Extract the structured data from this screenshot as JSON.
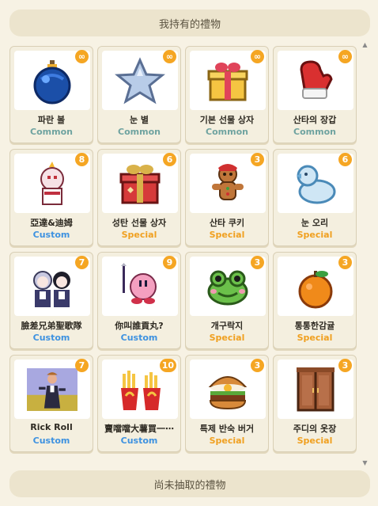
{
  "top_header": {
    "title": "我持有的禮物"
  },
  "bottom_header": {
    "title": "尚未抽取的禮物"
  },
  "scrollbar": {
    "up_arrow": "▲",
    "down_arrow": "▼"
  },
  "gifts": [
    {
      "name": "파란 볼",
      "rarity": "Common",
      "count": "∞",
      "icon": "blue-ornament-icon"
    },
    {
      "name": "눈 별",
      "rarity": "Common",
      "count": "∞",
      "icon": "snow-star-icon"
    },
    {
      "name": "기본 선물 상자",
      "rarity": "Common",
      "count": "∞",
      "icon": "basic-gift-box-icon"
    },
    {
      "name": "산타의 장갑",
      "rarity": "Common",
      "count": "∞",
      "icon": "santa-mitten-icon"
    },
    {
      "name": "亞達&迪姆",
      "rarity": "Custom",
      "count": "8",
      "icon": "character-pair-icon"
    },
    {
      "name": "성탄 선물 상자",
      "rarity": "Special",
      "count": "6",
      "icon": "christmas-gift-box-icon"
    },
    {
      "name": "산타 쿠키",
      "rarity": "Special",
      "count": "3",
      "icon": "gingerbread-cookie-icon"
    },
    {
      "name": "눈 오리",
      "rarity": "Special",
      "count": "6",
      "icon": "snow-duck-icon"
    },
    {
      "name": "臉差兄弟聖歌隊",
      "rarity": "Custom",
      "count": "7",
      "icon": "choir-pair-icon"
    },
    {
      "name": "你叫誰貢丸?",
      "rarity": "Custom",
      "count": "9",
      "icon": "pink-ball-character-icon"
    },
    {
      "name": "개구락지",
      "rarity": "Special",
      "count": "3",
      "icon": "frog-icon"
    },
    {
      "name": "통통한감귤",
      "rarity": "Special",
      "count": "3",
      "icon": "tangerine-icon"
    },
    {
      "name": "Rick Roll",
      "rarity": "Custom",
      "count": "7",
      "icon": "rick-roll-image-icon"
    },
    {
      "name": "賣噹噹大薯買一⋯",
      "rarity": "Custom",
      "count": "10",
      "icon": "french-fries-icon"
    },
    {
      "name": "특제 반숙 버거",
      "rarity": "Special",
      "count": "3",
      "icon": "burger-icon"
    },
    {
      "name": "주디의 옷장",
      "rarity": "Special",
      "count": "3",
      "icon": "wardrobe-icon"
    }
  ]
}
